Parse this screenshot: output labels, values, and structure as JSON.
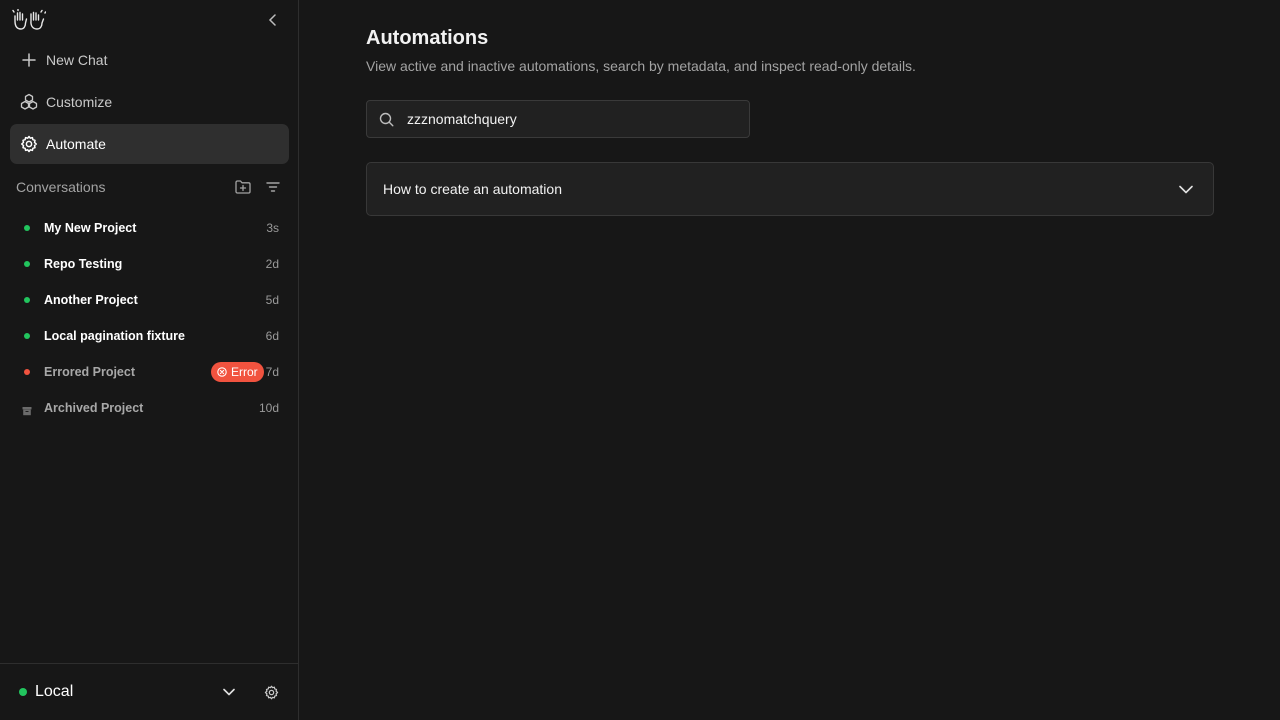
{
  "sidebar": {
    "nav": [
      {
        "label": "New Chat",
        "icon": "plus-icon"
      },
      {
        "label": "Customize",
        "icon": "cubes-icon"
      },
      {
        "label": "Automate",
        "icon": "gear-icon",
        "active": true
      }
    ],
    "conversations_label": "Conversations",
    "conversations": [
      {
        "title": "My New Project",
        "time": "3s",
        "status": "active"
      },
      {
        "title": "Repo Testing",
        "time": "2d",
        "status": "active"
      },
      {
        "title": "Another Project",
        "time": "5d",
        "status": "active"
      },
      {
        "title": "Local pagination fixture",
        "time": "6d",
        "status": "active"
      },
      {
        "title": "Errored Project",
        "time": "7d",
        "status": "error",
        "badge": "Error"
      },
      {
        "title": "Archived Project",
        "time": "10d",
        "status": "archived"
      }
    ],
    "footer": {
      "environment": "Local"
    }
  },
  "main": {
    "title": "Automations",
    "subtitle": "View active and inactive automations, search by metadata, and inspect read-only details.",
    "search": {
      "value": "zzznomatchquery"
    },
    "accordion_title": "How to create an automation"
  },
  "colors": {
    "background": "#171717",
    "active_dot": "#22c55e",
    "error": "#f1533f",
    "archived": "#6b6b6b"
  }
}
